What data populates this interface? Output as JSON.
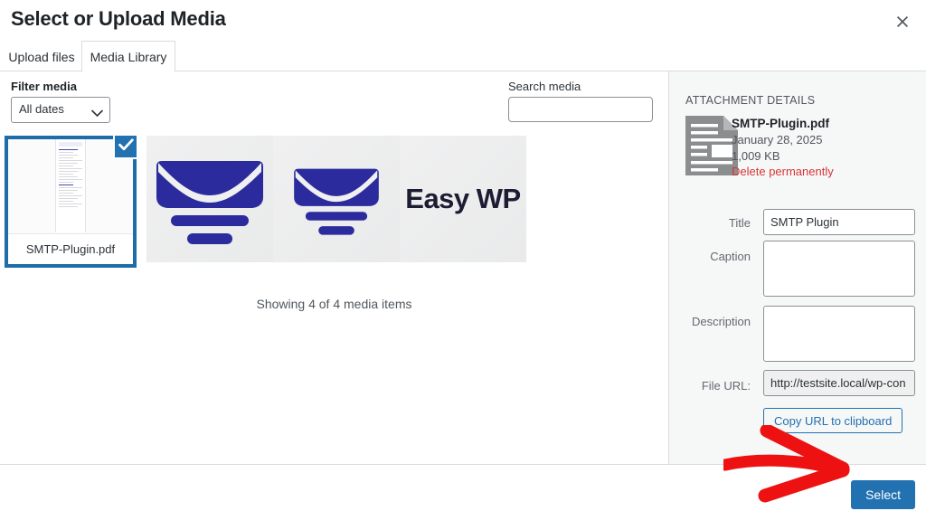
{
  "header": {
    "title": "Select or Upload Media",
    "close_icon": "close-icon"
  },
  "tabs": [
    {
      "label": "Upload files",
      "active": false
    },
    {
      "label": "Media Library",
      "active": true
    }
  ],
  "toolbar": {
    "filter_label": "Filter media",
    "date_filter_value": "All dates",
    "date_filter_options": [
      "All dates"
    ],
    "search_label": "Search media",
    "search_value": "",
    "search_placeholder": ""
  },
  "grid": {
    "items": [
      {
        "name": "SMTP-Plugin.pdf",
        "type": "pdf",
        "selected": true
      },
      {
        "name": "envelope-large",
        "type": "image",
        "selected": false
      },
      {
        "name": "envelope-small",
        "type": "image",
        "selected": false
      },
      {
        "name": "Easy WP",
        "type": "image",
        "selected": false
      }
    ],
    "status": "Showing 4 of 4 media items"
  },
  "sidebar": {
    "heading": "ATTACHMENT DETAILS",
    "attachment": {
      "filename": "SMTP-Plugin.pdf",
      "date": "January 28, 2025",
      "size": "1,009 KB",
      "delete_label": "Delete permanently"
    },
    "fields": {
      "title_label": "Title",
      "title_value": "SMTP Plugin",
      "caption_label": "Caption",
      "caption_value": "",
      "description_label": "Description",
      "description_value": "",
      "file_url_label": "File URL:",
      "file_url_value": "http://testsite.local/wp-con"
    },
    "copy_button": "Copy URL to clipboard"
  },
  "footer": {
    "select_button": "Select"
  },
  "colors": {
    "accent_blue": "#2271b1",
    "selected_border": "#1e6ca8",
    "delete_red": "#d63638",
    "annotation_red": "#ee1111",
    "logo_blue": "#2b2b9e",
    "sidebar_bg": "#f6f7f7"
  }
}
